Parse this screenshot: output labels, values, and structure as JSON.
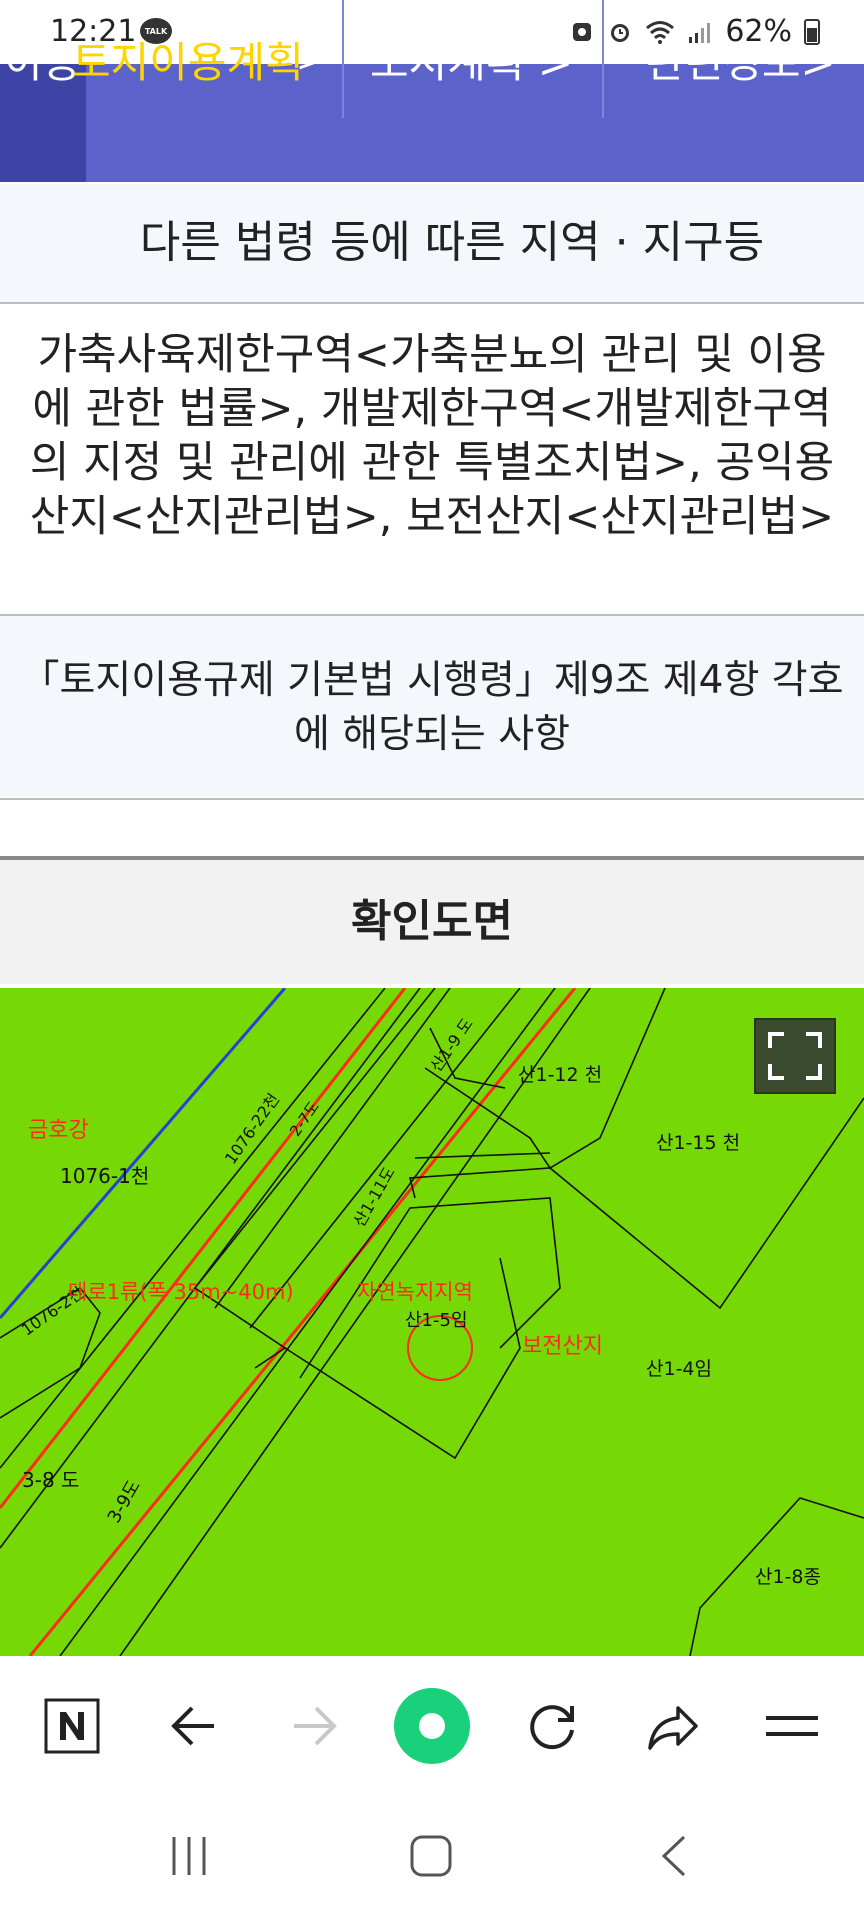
{
  "status_bar": {
    "time": "12:21",
    "talk_badge": "TALK",
    "battery": "62%"
  },
  "tabs": {
    "move_label": "이동",
    "items": [
      {
        "label": "토지이용계획"
      },
      {
        "label": "도시계획 >"
      },
      {
        "label": "관련정보>"
      }
    ]
  },
  "section_other_laws": {
    "title": "다른 법령 등에 따른 지역 · 지구등",
    "content": "가축사육제한구역<가축분뇨의 관리 및 이용에 관한 법률>, 개발제한구역<개발제한구역의 지정 및 관리에 관한 특별조치법>, 공익용산지<산지관리법>, 보전산지<산지관리법>"
  },
  "section_enforcement": {
    "title": "「토지이용규제 기본법 시행령」제9조 제4항 각호에 해당되는 사항"
  },
  "map_section": {
    "title": "확인도면",
    "labels": {
      "river": "금호강",
      "parcel_1076_1": "1076-1천",
      "parcel_1076_2": "1076-2천",
      "parcel_38": "3-8 도",
      "parcel_39": "3-9도",
      "road_class": "대로1류(폭 35m~40m)",
      "natural_green": "자연녹지지역",
      "parcel_s15": "산1-5임",
      "conservation": "보전산지",
      "parcel_s14": "산1-4임",
      "parcel_s112": "산1-12 천",
      "parcel_s115": "산1-15 천",
      "parcel_s19": "산1-9 도",
      "parcel_s18": "산1-8종",
      "parcel_s11": "산1-11도",
      "parcel_1076_22": "1076-22천",
      "parcel_27": "2-7도"
    }
  },
  "colors": {
    "tab_bg": "#5b62c9",
    "tab_active": "#ffd400",
    "map_bg": "#76d906",
    "map_red": "#ff2a1a",
    "map_blue": "#2a3fd6",
    "nav_green": "#19d17a"
  },
  "bottom_nav": {
    "icons": [
      "naver-home-icon",
      "back-arrow-icon",
      "forward-arrow-icon",
      "green-dot-icon",
      "refresh-icon",
      "share-icon",
      "menu-icon"
    ]
  },
  "system_nav": {
    "icons": [
      "recent-apps-icon",
      "home-icon",
      "back-icon"
    ]
  }
}
